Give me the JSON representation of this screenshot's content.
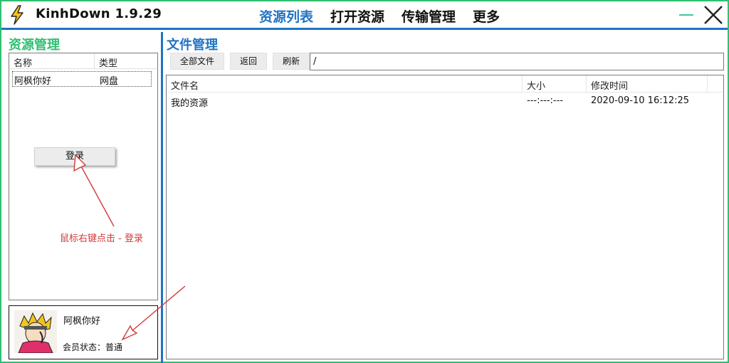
{
  "app": {
    "title": "KinhDown 1.9.29",
    "logo_icon": "lightning-bolt-icon"
  },
  "nav": {
    "items": [
      {
        "label": "资源列表",
        "active": true
      },
      {
        "label": "打开资源",
        "active": false
      },
      {
        "label": "传输管理",
        "active": false
      },
      {
        "label": "更多",
        "active": false
      }
    ]
  },
  "window_controls": {
    "minimize_icon": "minimize-icon",
    "close_icon": "close-icon"
  },
  "left_panel": {
    "title": "资源管理",
    "table": {
      "columns": [
        "名称",
        "类型"
      ],
      "rows": [
        {
          "name": "阿枫你好",
          "type": "网盘"
        }
      ]
    },
    "login_button": "登录",
    "user": {
      "name": "阿枫你好",
      "member_label": "会员状态：",
      "member_status": "普通",
      "avatar_icon": "user-avatar-icon"
    }
  },
  "right_panel": {
    "title": "文件管理",
    "toolbar": {
      "all_files": "全部文件",
      "back": "返回",
      "refresh": "刷新"
    },
    "path": "/",
    "table": {
      "columns": [
        "文件名",
        "大小",
        "修改时间"
      ],
      "rows": [
        {
          "name": "我的资源",
          "size": "---:---:---",
          "modified": "2020-09-10 16:12:25"
        }
      ]
    }
  },
  "annotation": {
    "text": "鼠标右键点击 - 登录",
    "color": "#d23b3b"
  },
  "colors": {
    "accent_blue": "#1f73c4",
    "accent_green": "#2fbf71",
    "minimize_teal": "#3fc6a3"
  }
}
